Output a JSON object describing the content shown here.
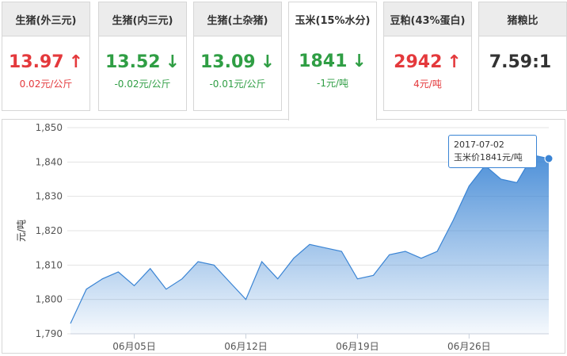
{
  "cards": [
    {
      "title": "生猪(外三元)",
      "value": "13.97",
      "arrow": "↑",
      "trend": "up",
      "change": "0.02元/公斤"
    },
    {
      "title": "生猪(内三元)",
      "value": "13.52",
      "arrow": "↓",
      "trend": "down",
      "change": "-0.02元/公斤"
    },
    {
      "title": "生猪(土杂猪)",
      "value": "13.09",
      "arrow": "↓",
      "trend": "down",
      "change": "-0.01元/公斤"
    },
    {
      "title": "玉米(15%水分)",
      "value": "1841",
      "arrow": "↓",
      "trend": "down",
      "change": "-1元/吨"
    },
    {
      "title": "豆粕(43%蛋白)",
      "value": "2942",
      "arrow": "↑",
      "trend": "up",
      "change": "4元/吨"
    },
    {
      "title": "猪粮比",
      "value": "7.59:1",
      "arrow": "",
      "trend": "flat",
      "change": ""
    }
  ],
  "tooltip": {
    "date": "2017-07-02",
    "label": "玉米价1841元/吨"
  },
  "chart_data": {
    "type": "area",
    "ylabel": "元/吨",
    "ylim": [
      1790,
      1850
    ],
    "yticks": [
      "1,790",
      "1,800",
      "1,810",
      "1,820",
      "1,830",
      "1,840",
      "1,850"
    ],
    "xticks": [
      {
        "day": 4,
        "label": "06月05日"
      },
      {
        "day": 11,
        "label": "06月12日"
      },
      {
        "day": 18,
        "label": "06月19日"
      },
      {
        "day": 25,
        "label": "06月26日"
      }
    ],
    "x": [
      0,
      1,
      2,
      3,
      4,
      5,
      6,
      7,
      8,
      9,
      10,
      11,
      12,
      13,
      14,
      15,
      16,
      17,
      18,
      19,
      20,
      21,
      22,
      23,
      24,
      25,
      26,
      27,
      28,
      29,
      30
    ],
    "values": [
      1793,
      1803,
      1806,
      1808,
      1804,
      1809,
      1803,
      1806,
      1811,
      1810,
      1805,
      1800,
      1811,
      1806,
      1812,
      1816,
      1815,
      1814,
      1806,
      1807,
      1813,
      1814,
      1812,
      1814,
      1823,
      1833,
      1839,
      1835,
      1834,
      1842,
      1841
    ],
    "color": "#3a84d4",
    "grid": true
  }
}
